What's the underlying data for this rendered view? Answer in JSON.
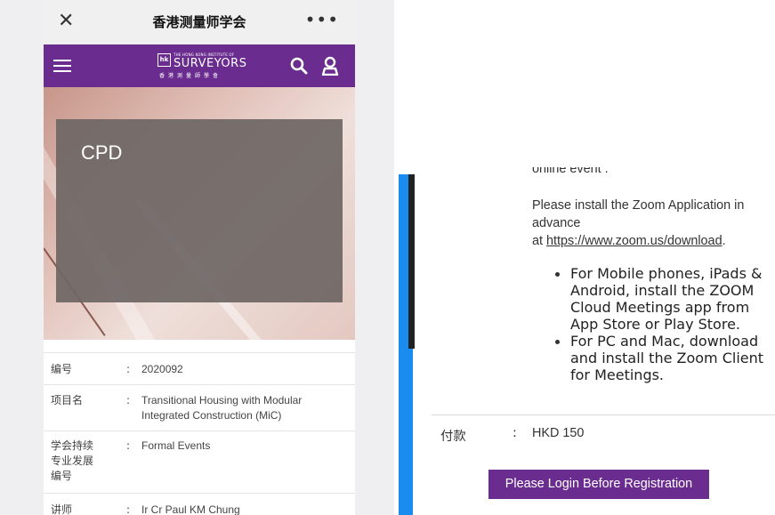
{
  "wechat": {
    "close_icon": "close-icon",
    "title": "香港测量师学会",
    "more_icon": "more-dots-icon"
  },
  "nav": {
    "background": "#6a2c8e",
    "menu_icon": "hamburger-icon",
    "logo_small": "THE HONG KONG INSTITUTE OF",
    "logo_main": "SURVEYORS",
    "logo_cn": "香港測量師學會",
    "search_icon": "search-icon",
    "user_icon": "user-icon"
  },
  "hero": {
    "title": "CPD"
  },
  "details": [
    {
      "label": "编号",
      "colon": ":",
      "value": "2020092"
    },
    {
      "label": "项目名",
      "colon": ":",
      "value": "Transitional Housing with Modular Integrated Construction (MiC)"
    },
    {
      "label": "学会持续专业发展编号",
      "colon": ":",
      "value": "Formal Events"
    },
    {
      "label": "讲师",
      "colon": ":",
      "value": "Ir Cr Paul KM Chung"
    }
  ],
  "right": {
    "cut_text": "online event .",
    "install_text": "Please install the Zoom Application in advance",
    "at_text": "at ",
    "zoom_link": "https://www.zoom.us/download",
    "after_link": ".",
    "bullets": [
      "For Mobile phones, iPads & Android, install the ZOOM Cloud Meetings app from App Store or Play Store.",
      "For PC and Mac, download and install the Zoom Client for Meetings."
    ],
    "payment_label": "付款",
    "payment_colon": ":",
    "payment_value": "HKD 150",
    "login_button": "Please Login Before Registration"
  }
}
